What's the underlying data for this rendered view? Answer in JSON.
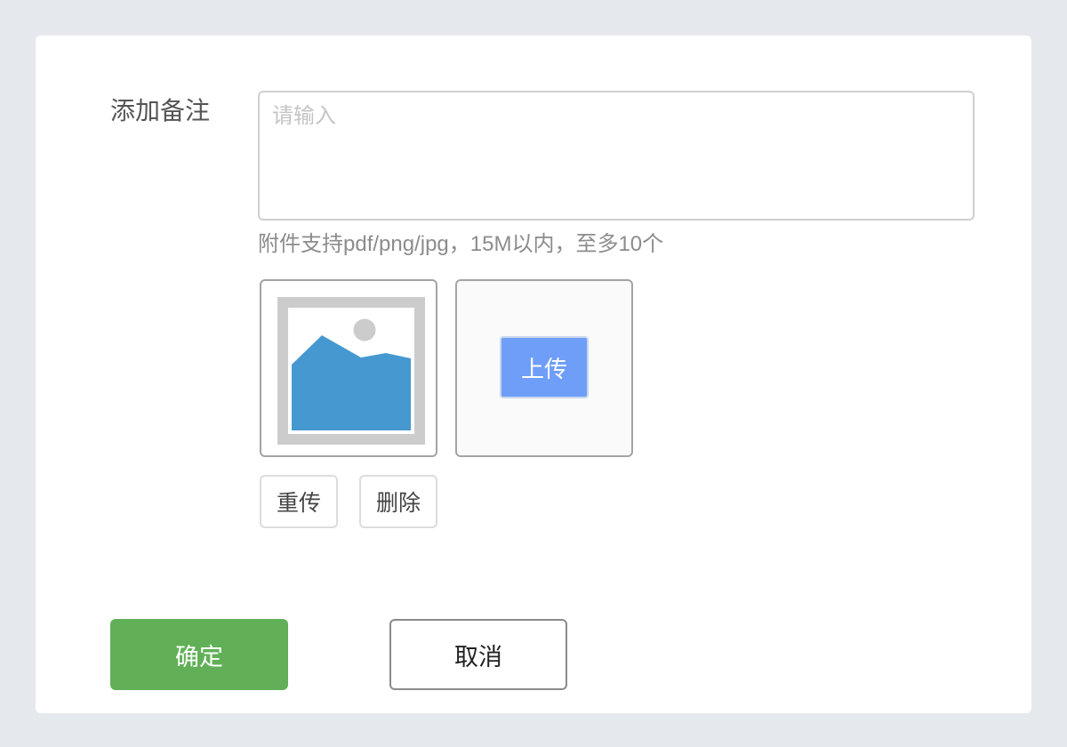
{
  "form": {
    "remark_label": "添加备注",
    "remark_value": "",
    "remark_placeholder": "请输入",
    "attachment_hint": "附件支持pdf/png/jpg，15M以内，至多10个"
  },
  "attachments": {
    "preview_icon": "image-placeholder-icon",
    "upload_label": "上传",
    "reupload_label": "重传",
    "delete_label": "删除"
  },
  "footer": {
    "confirm_label": "确定",
    "cancel_label": "取消"
  },
  "colors": {
    "page_background": "#e5e8ec",
    "confirm": "#61b057",
    "upload": "#6f9ef8",
    "image_mountain": "#4699d0",
    "image_frame": "#cccccc"
  }
}
